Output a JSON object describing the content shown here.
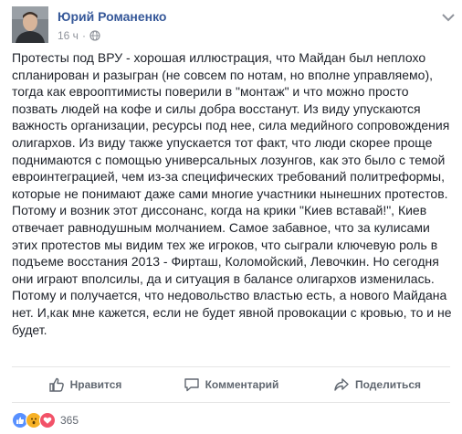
{
  "post": {
    "author": "Юрий Романенко",
    "time": "16 ч",
    "audience_icon": "globe-icon",
    "body": "Протесты под ВРУ - хорошая иллюстрация, что Майдан был неплохо\nспланирован и разыгран (не совсем по нотам, но вполне управляемо),\nтогда как еврооптимисты поверили в \"монтаж\" и что можно просто\nпозвать людей на кофе и силы добра восстанут. Из виду упускаются\nважность организации, ресурсы под нее, сила медийного сопровождения\nолигархов. Из виду также упускается тот факт, что люди скорее проще\nподнимаются с помощью универсальных лозунгов, как это было с темой\nевроинтеграцией, чем из-за специфических требований политреформы,\nкоторые не понимают даже сами многие участники нынешних протестов.\nПотому и возник этот диссонанс, когда на крики \"Киев вставай!\", Киев\nотвечает равнодушным молчанием. Самое забавное, что за кулисами\nэтих протестов мы видим тех же игроков, что сыграли ключевую роль в\nподъеме восстания 2013 - Фирташ, Коломойский, Левочкин. Но сегодня\nони играют вполсилы, да и ситуация в балансе олигархов изменилась.\nПотому и получается, что недовольство властью есть, а нового Майдана\nнет. И,как мне кажется, если не будет явной провокации с кровью, то и не\nбудет."
  },
  "actions": {
    "like": "Нравится",
    "comment": "Комментарий",
    "share": "Поделиться"
  },
  "reactions": {
    "icons": [
      "like-reaction",
      "wow-reaction",
      "love-reaction"
    ],
    "count": "365",
    "colors": {
      "like": "#5890ff",
      "wow": "#f7b125",
      "love": "#f25268"
    }
  }
}
